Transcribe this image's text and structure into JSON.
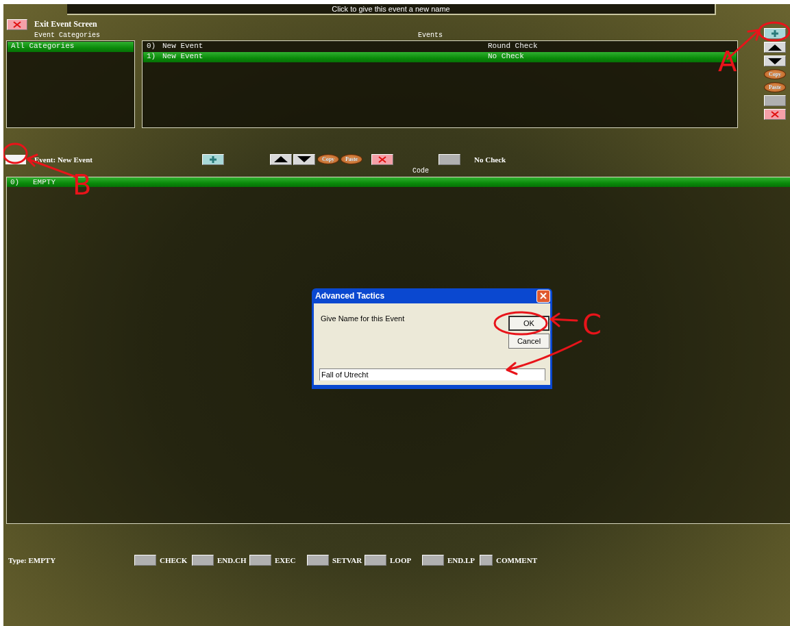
{
  "title_bar": {
    "text": "Click to give this event a new name"
  },
  "exit_button": {
    "label": "Exit Event Screen"
  },
  "categories": {
    "heading": "Event Categories",
    "items": [
      {
        "label": "All Categories",
        "selected": true
      }
    ]
  },
  "events": {
    "heading": "Events",
    "rows": [
      {
        "number": "0)",
        "name": "New Event",
        "check": "Round Check",
        "selected": false
      },
      {
        "number": "1)",
        "name": "New Event",
        "check": "No Check",
        "selected": true
      }
    ]
  },
  "event_tools": [
    {
      "kind": "add"
    },
    {
      "kind": "up"
    },
    {
      "kind": "down"
    },
    {
      "kind": "copy",
      "label": "Copy"
    },
    {
      "kind": "paste",
      "label": "Paste"
    },
    {
      "kind": "blank"
    },
    {
      "kind": "delete"
    }
  ],
  "event_editor": {
    "name": "Event: New Event",
    "tools": [
      {
        "kind": "add"
      },
      {
        "kind": "up"
      },
      {
        "kind": "down"
      },
      {
        "kind": "copy",
        "label": "Copy"
      },
      {
        "kind": "paste",
        "label": "Paste"
      },
      {
        "kind": "delete"
      },
      {
        "kind": "blank"
      }
    ],
    "check_label": "No Check",
    "code_heading": "Code",
    "code_rows": [
      {
        "number": "0)",
        "text": "EMPTY",
        "selected": true
      }
    ]
  },
  "type_bar": {
    "label": "Type: EMPTY",
    "buttons": [
      {
        "label": "CHECK"
      },
      {
        "label": "END.CH"
      },
      {
        "label": "EXEC"
      },
      {
        "label": "SETVAR"
      },
      {
        "label": "LOOP"
      },
      {
        "label": "END.LP"
      },
      {
        "label": "COMMENT"
      }
    ]
  },
  "dialog": {
    "title": "Advanced Tactics",
    "prompt": "Give Name for this Event",
    "buttons": [
      {
        "label": "OK",
        "selected": true
      },
      {
        "label": "Cancel",
        "selected": false
      }
    ],
    "value": "Fall of Utrecht"
  },
  "annotations": [
    {
      "label": "A"
    },
    {
      "label": "B"
    },
    {
      "label": "C"
    }
  ]
}
